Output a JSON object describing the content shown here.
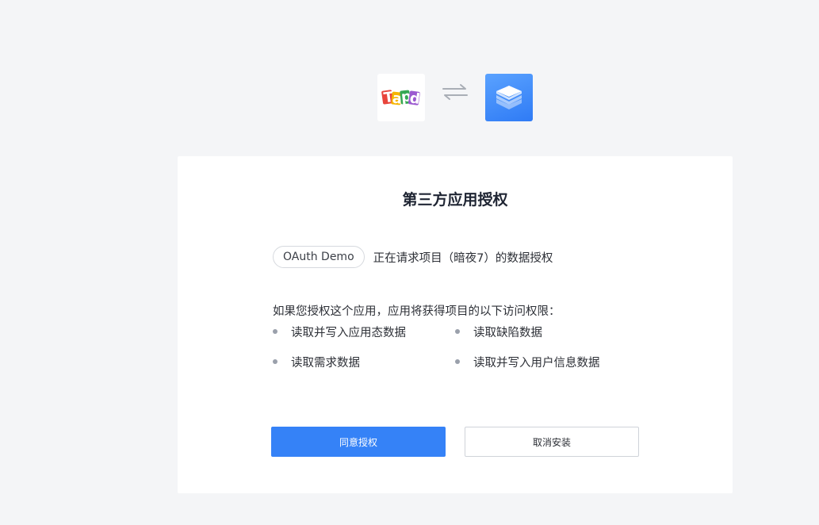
{
  "header": {
    "left_logo": {
      "icon": "tapd-logo-icon",
      "text": "Tapd"
    },
    "swap_icon": "swap-arrows-icon",
    "right_logo": {
      "icon": "stacked-layers-icon"
    }
  },
  "card": {
    "title": "第三方应用授权",
    "request": {
      "app_name": "OAuth Demo",
      "message": "正在请求项目（暗夜7）的数据授权"
    },
    "permissions": {
      "intro": "如果您授权这个应用，应用将获得项目的以下访问权限：",
      "items": [
        "读取并写入应用态数据",
        "读取缺陷数据",
        "读取需求数据",
        "读取并写入用户信息数据"
      ]
    },
    "buttons": {
      "agree": "同意授权",
      "cancel": "取消安装"
    }
  },
  "colors": {
    "background": "#f4f5f7",
    "card": "#ffffff",
    "primary": "#3582f7",
    "text": "#2c2f36",
    "title": "#1f2533"
  }
}
